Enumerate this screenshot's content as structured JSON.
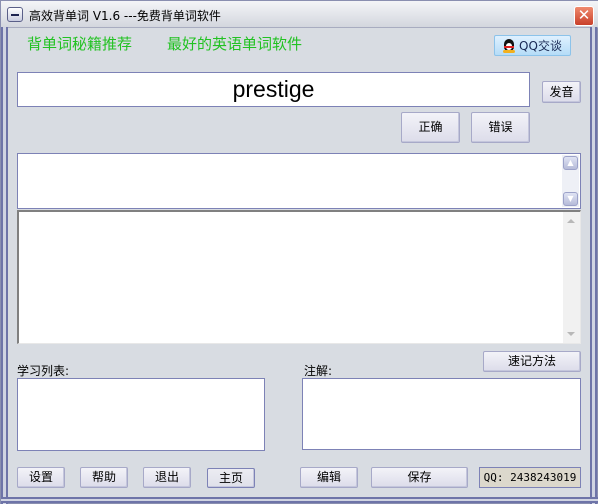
{
  "window": {
    "title": "高效背单词 V1.6  ---免费背单词软件",
    "close_label": "✕"
  },
  "header": {
    "links": [
      "背单词秘籍推荐",
      "最好的英语单词软件"
    ],
    "qq_chat_label": "QQ交谈",
    "link_color": "#22c222"
  },
  "word": {
    "current": "prestige",
    "pronounce_label": "发音",
    "correct_label": "正确",
    "wrong_label": "错误"
  },
  "panels": {
    "upper_text": "",
    "lower_text": ""
  },
  "study_list": {
    "label": "学习列表:",
    "items": []
  },
  "notes": {
    "label": "注解:",
    "memo_method_label": "速记方法",
    "content": ""
  },
  "footer": {
    "buttons": [
      "设置",
      "帮助",
      "退出",
      "主页",
      "编辑",
      "保存"
    ],
    "qq_number": "QQ: 2438243019"
  },
  "icons": {
    "system_menu": "minus-box-icon",
    "close": "close-x-icon",
    "qq": "qq-penguin-icon",
    "scroll_up": "▲",
    "scroll_down": "▼"
  }
}
